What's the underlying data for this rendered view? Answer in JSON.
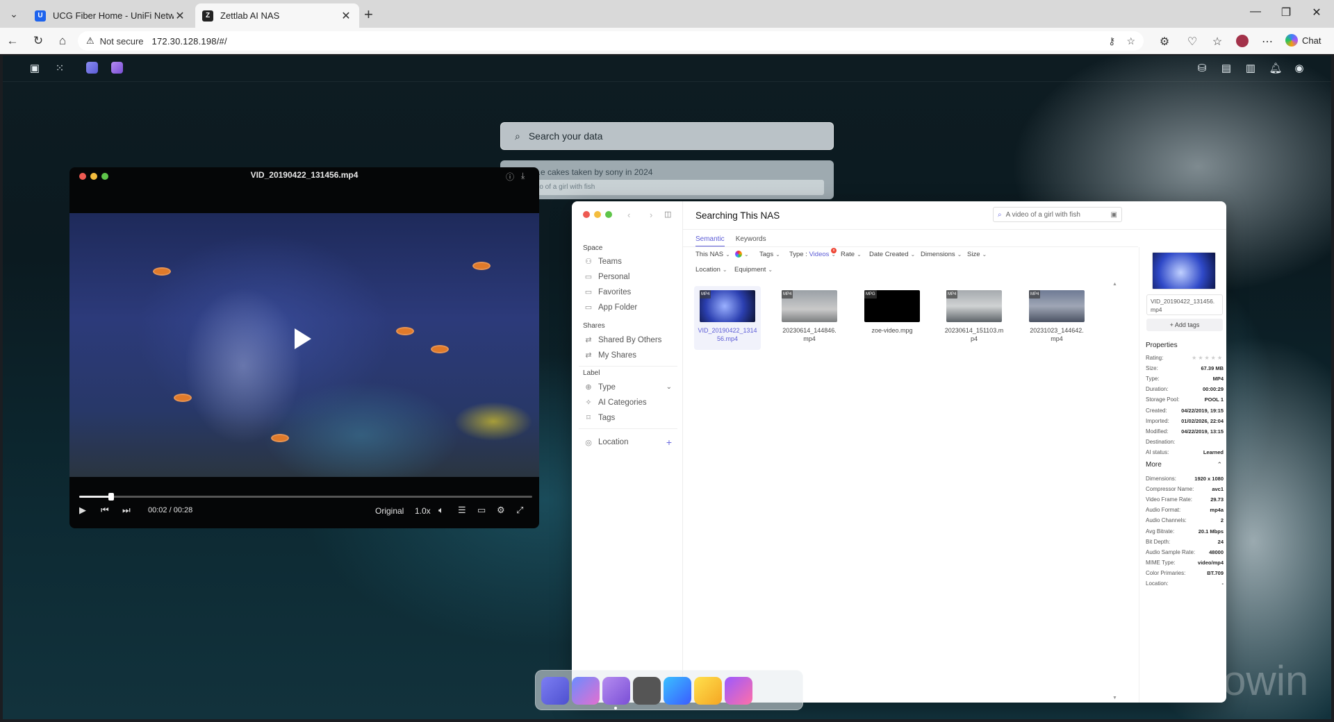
{
  "browser": {
    "tabs": [
      {
        "title": "UCG Fiber Home - UniFi Network",
        "favicon_letter": "U"
      },
      {
        "title": "Zettlab AI NAS",
        "favicon_letter": "Z"
      }
    ],
    "address": {
      "security_label": "Not secure",
      "url": "172.30.128.198/#/"
    },
    "chat_label": "Chat"
  },
  "desktop": {
    "search_placeholder": "Search your data",
    "suggestions": [
      "...e cakes taken by sony in 2024",
      "...o of a girl with fish"
    ],
    "watermark": "owin"
  },
  "player": {
    "title": "VID_20190422_131456.mp4",
    "time": "00:02 / 00:28",
    "progress": 0.07,
    "quality": "Original",
    "speed": "1.0x"
  },
  "search_window": {
    "title": "Searching This NAS",
    "search_query": "A video of a girl with fish",
    "tabs": [
      "Semantic",
      "Keywords"
    ],
    "active_tab": "Semantic",
    "filters": {
      "this_nas": "This NAS",
      "tags": "Tags",
      "type_label": "Type :",
      "type_value": "Videos",
      "type_badge": "x",
      "rate": "Rate",
      "date_created": "Date Created",
      "dimensions": "Dimensions",
      "size": "Size",
      "location": "Location",
      "equipment": "Equipment"
    },
    "sidebar": {
      "space_heading": "Space",
      "space_items": [
        "Teams",
        "Personal",
        "Favorites",
        "App Folder"
      ],
      "shares_heading": "Shares",
      "shares_items": [
        "Shared By Others",
        "My Shares"
      ],
      "label_heading": "Label",
      "label_items": [
        "Type",
        "AI Categories",
        "Tags"
      ],
      "location": "Location"
    },
    "files": [
      {
        "badge": "MP4",
        "name_line1": "VID_20190422_1314",
        "name_line2": "56.mp4"
      },
      {
        "badge": "MP4",
        "name_line1": "20230614_144846.",
        "name_line2": "mp4"
      },
      {
        "badge": "MPG",
        "name_line1": "zoe-video.mpg",
        "name_line2": ""
      },
      {
        "badge": "MP4",
        "name_line1": "20230614_151103.m",
        "name_line2": "p4"
      },
      {
        "badge": "MP4",
        "name_line1": "20231023_144642.",
        "name_line2": "mp4"
      }
    ],
    "details": {
      "file_name": "VID_20190422_131456.mp4",
      "add_tags": "Add tags",
      "properties_heading": "Properties",
      "properties": [
        {
          "label": "Rating:",
          "value": ""
        },
        {
          "label": "Size:",
          "value": "67.39 MB"
        },
        {
          "label": "Type:",
          "value": "MP4"
        },
        {
          "label": "Duration:",
          "value": "00:00:29"
        },
        {
          "label": "Storage Pool:",
          "value": "POOL 1"
        },
        {
          "label": "Created:",
          "value": "04/22/2019, 19:15"
        },
        {
          "label": "Imported:",
          "value": "01/02/2026, 22:04"
        },
        {
          "label": "Modified:",
          "value": "04/22/2019, 13:15"
        },
        {
          "label": "Destination:",
          "value": ""
        },
        {
          "label": "AI status:",
          "value": "Learned"
        }
      ],
      "rating": 0,
      "more_heading": "More",
      "more": [
        {
          "label": "Dimensions:",
          "value": "1920 x 1080"
        },
        {
          "label": "Compressor Name:",
          "value": "avc1"
        },
        {
          "label": "Video Frame Rate:",
          "value": "29.73"
        },
        {
          "label": "Audio Format:",
          "value": "mp4a"
        },
        {
          "label": "Audio Channels:",
          "value": "2"
        },
        {
          "label": "Avg Bitrate:",
          "value": "20.1 Mbps"
        },
        {
          "label": "Bit Depth:",
          "value": "24"
        },
        {
          "label": "Audio Sample Rate:",
          "value": "48000"
        },
        {
          "label": "MIME Type:",
          "value": "video/mp4"
        },
        {
          "label": "Color Primaries:",
          "value": "BT.709"
        },
        {
          "label": "Location:",
          "value": "-"
        }
      ]
    }
  },
  "colors": {
    "accent": "#5b5bd6",
    "close_red": "#ee5a52",
    "min_yellow": "#f4bd3e",
    "max_green": "#5fc54a"
  }
}
